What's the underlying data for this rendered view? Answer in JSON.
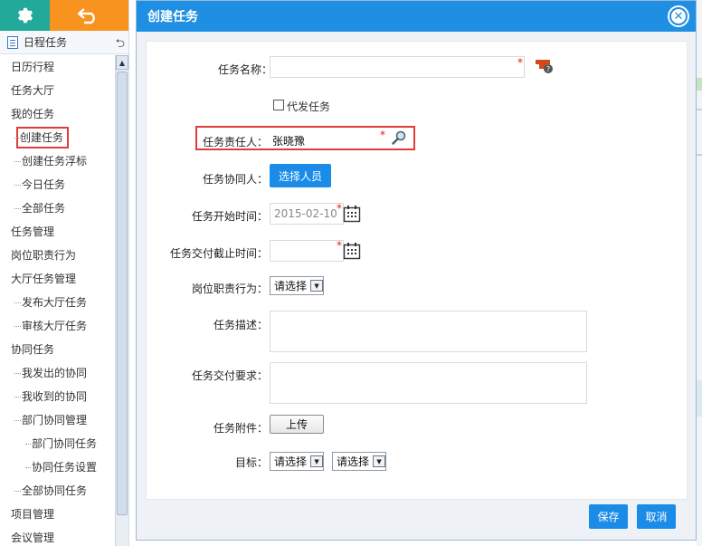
{
  "sidebar": {
    "header_title": "日程任务",
    "items": [
      {
        "label": "日历行程",
        "level": 0
      },
      {
        "label": "任务大厅",
        "level": 0
      },
      {
        "label": "我的任务",
        "level": 0
      },
      {
        "label": "创建任务",
        "level": 1,
        "active": true
      },
      {
        "label": "创建任务浮标",
        "level": 1
      },
      {
        "label": "今日任务",
        "level": 1
      },
      {
        "label": "全部任务",
        "level": 1
      },
      {
        "label": "任务管理",
        "level": 0
      },
      {
        "label": "岗位职责行为",
        "level": 0
      },
      {
        "label": "大厅任务管理",
        "level": 0
      },
      {
        "label": "发布大厅任务",
        "level": 1
      },
      {
        "label": "审核大厅任务",
        "level": 1
      },
      {
        "label": "协同任务",
        "level": 0
      },
      {
        "label": "我发出的协同",
        "level": 1
      },
      {
        "label": "我收到的协同",
        "level": 1
      },
      {
        "label": "部门协同管理",
        "level": 1
      },
      {
        "label": "部门协同任务",
        "level": 2
      },
      {
        "label": "协同任务设置",
        "level": 2
      },
      {
        "label": "全部协同任务",
        "level": 1
      },
      {
        "label": "项目管理",
        "level": 0
      },
      {
        "label": "会议管理",
        "level": 0
      }
    ]
  },
  "dialog": {
    "title": "创建任务",
    "fields": {
      "task_name_label": "任务名称：",
      "task_name_value": "",
      "proxy_label": "代发任务",
      "owner_label": "任务责任人：",
      "owner_value": "张晓豫",
      "assist_label": "任务协同人：",
      "assist_button": "选择人员",
      "start_label": "任务开始时间：",
      "start_value": "2015-02-10",
      "deadline_label": "任务交付截止时间：",
      "deadline_value": "",
      "duty_label": "岗位职责行为：",
      "duty_select": "请选择",
      "desc_label": "任务描述：",
      "req_label": "任务交付要求：",
      "attach_label": "任务附件：",
      "upload_button": "上传",
      "goal_label": "目标：",
      "goal_select_1": "请选择",
      "goal_select_2": "请选择",
      "required_mark": "*"
    },
    "footer": {
      "save": "保存",
      "cancel": "取消"
    }
  },
  "colors": {
    "title_bar": "#1f8fe3",
    "gear_bg": "#23a99a",
    "back_bg": "#f7931e",
    "highlight": "#e23b3b",
    "required": "#e02020"
  }
}
